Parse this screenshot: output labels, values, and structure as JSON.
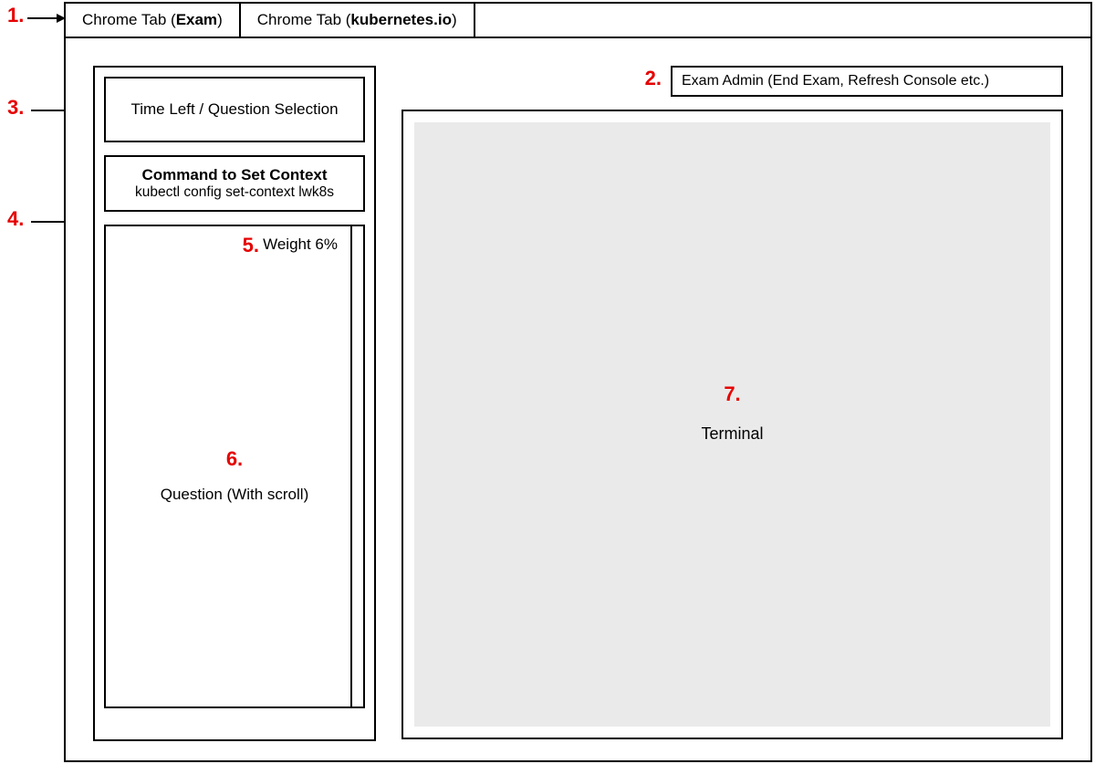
{
  "annotations": {
    "n1": "1.",
    "n2": "2.",
    "n3": "3.",
    "n4": "4.",
    "n5": "5.",
    "n6": "6.",
    "n7": "7."
  },
  "tabs": {
    "tab1_prefix": "Chrome Tab (",
    "tab1_bold": "Exam",
    "tab1_suffix": ")",
    "tab2_prefix": "Chrome Tab (",
    "tab2_bold": "kubernetes.io",
    "tab2_suffix": ")"
  },
  "sidebar": {
    "time_label": "Time Left / Question Selection",
    "context_title": "Command to Set Context",
    "context_cmd": "kubectl config set-context lwk8s",
    "weight_label": "Weight 6%",
    "question_label": "Question (With scroll)"
  },
  "admin": {
    "label": "Exam Admin (End Exam, Refresh Console etc.)"
  },
  "terminal": {
    "label": "Terminal"
  }
}
